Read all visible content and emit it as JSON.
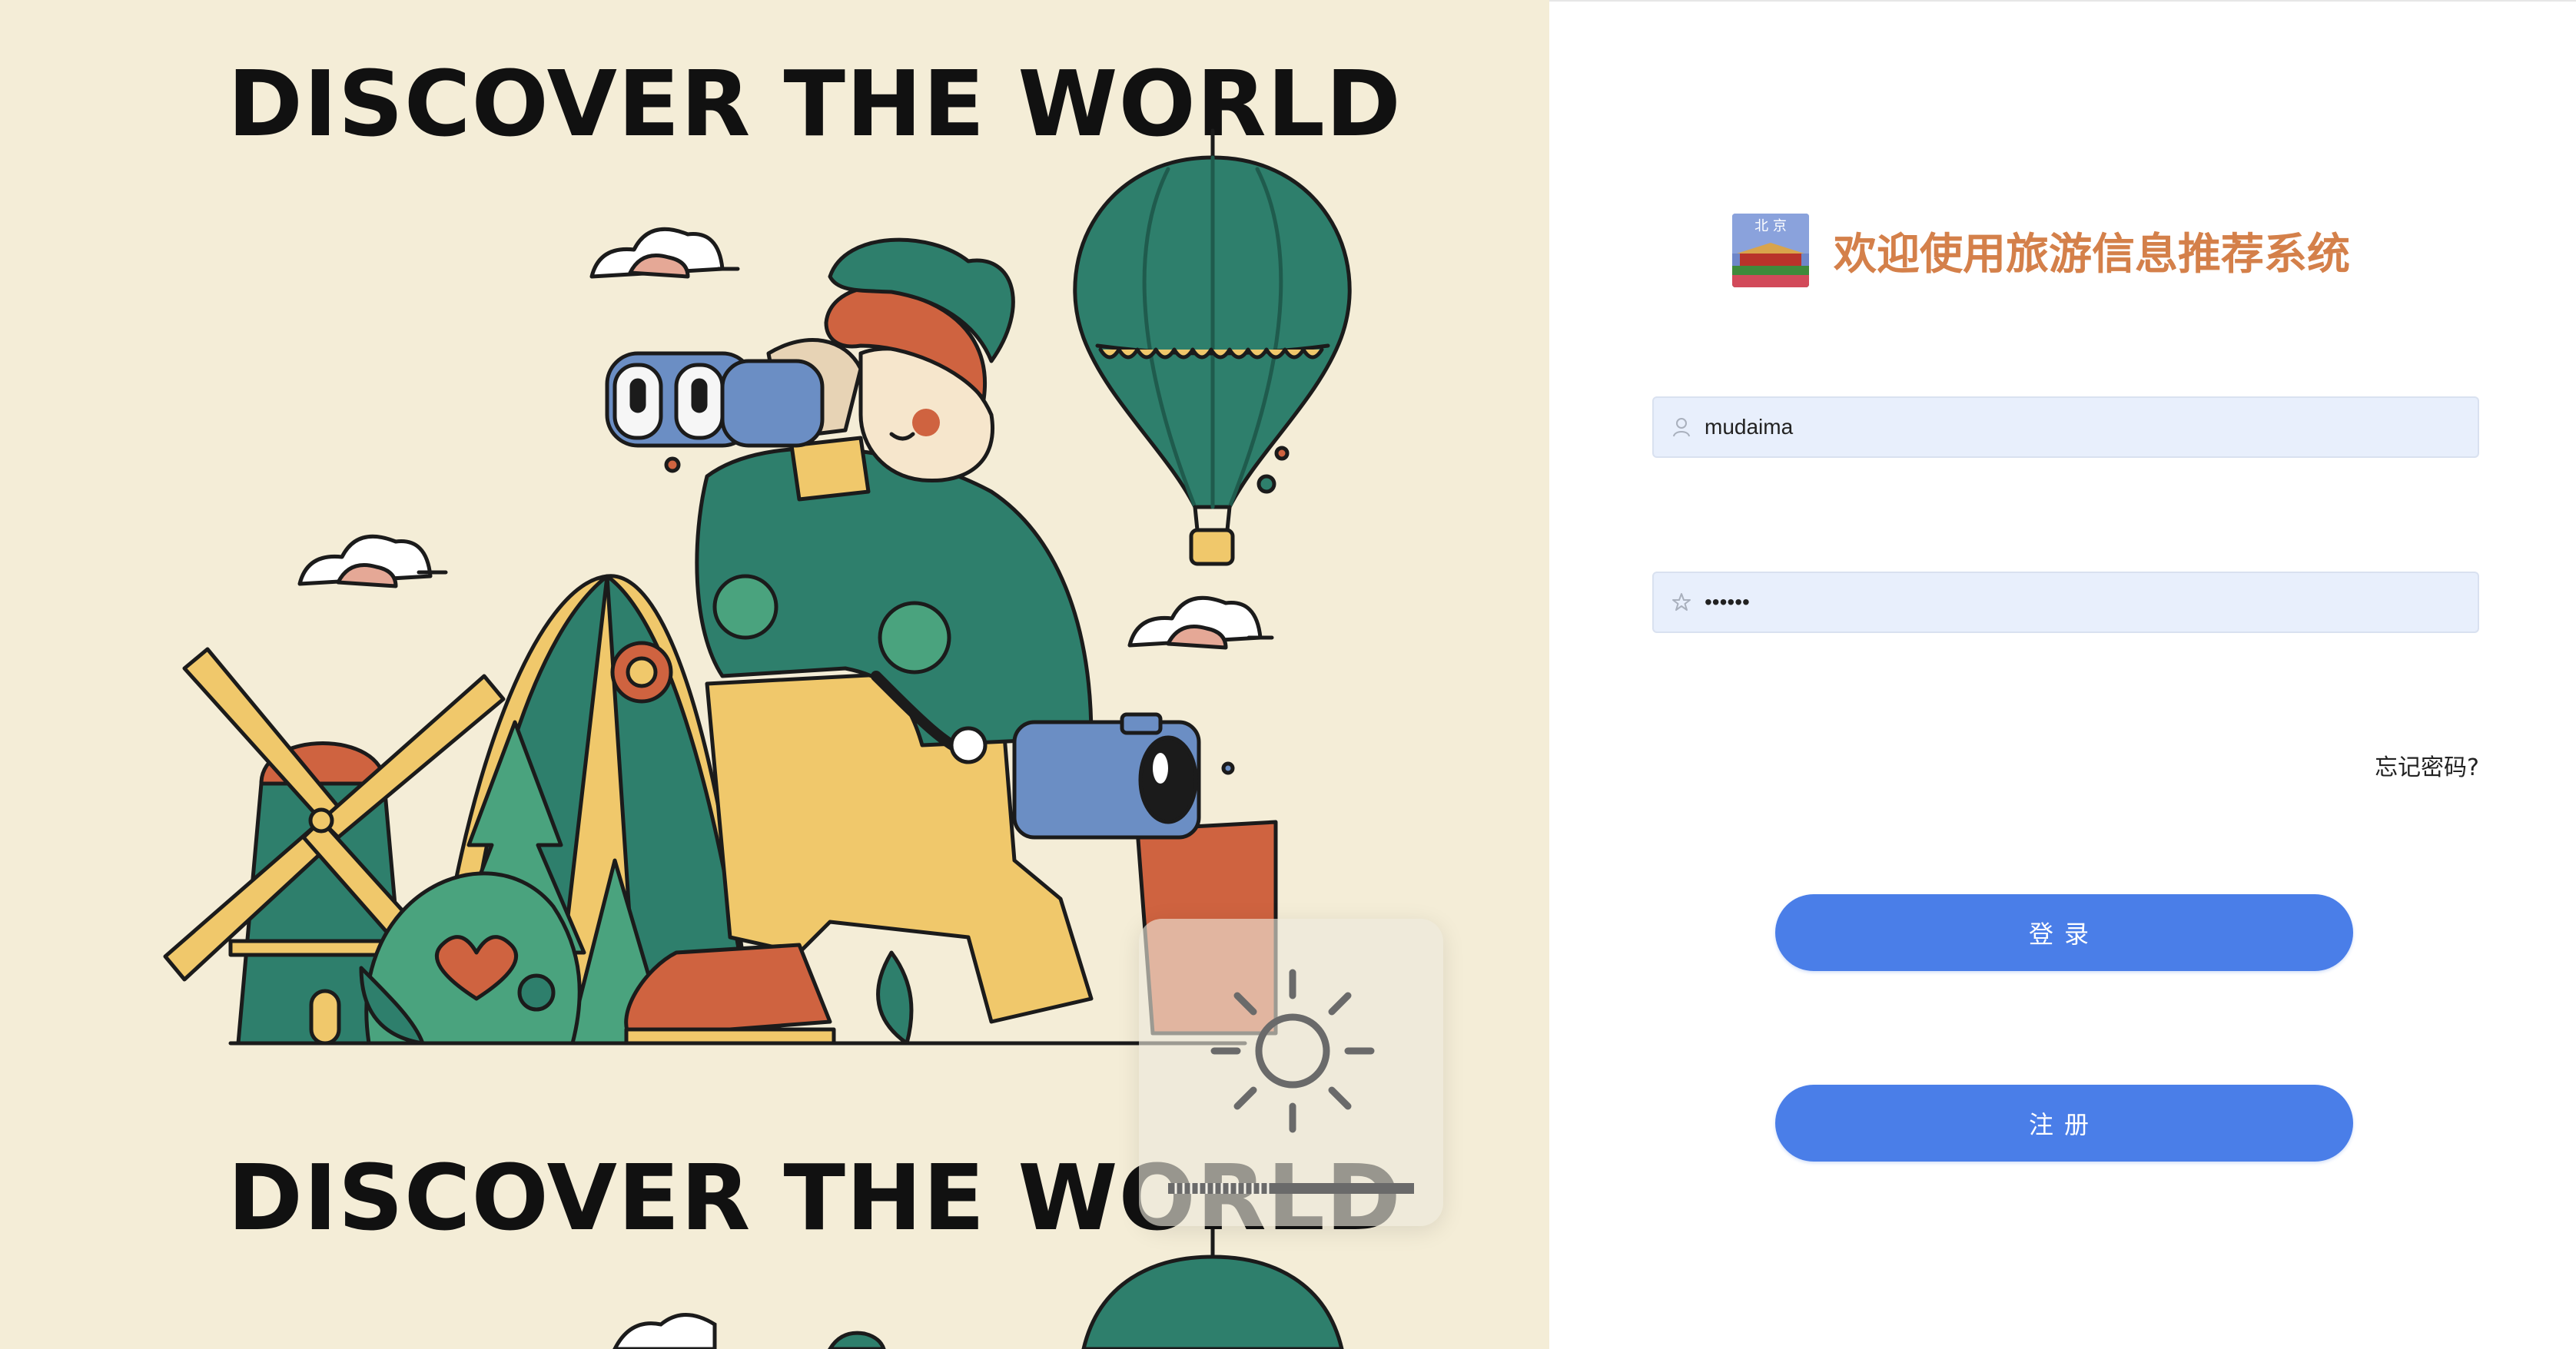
{
  "illustration": {
    "headline_top": "DISCOVER THE WORLD",
    "headline_bottom": "DISCOVER THE WORLD"
  },
  "brand": {
    "logo_icon": "beijing-tiananmen-logo",
    "title": "欢迎使用旅游信息推荐系统"
  },
  "login_form": {
    "username_value": "mudaima",
    "username_icon": "user-icon",
    "password_value": "••••••",
    "password_icon": "star-icon",
    "forgot_label": "忘记密码?",
    "login_label": "登录",
    "register_label": "注册"
  },
  "overlay": {
    "icon": "sun-brightness-icon"
  },
  "colors": {
    "left_background": "#f4edd7",
    "title_orange": "#d4804a",
    "button_blue": "#4a7ee8",
    "input_fill": "#e8effc",
    "teal": "#2e7f6c",
    "mustard": "#f0c86b",
    "rust": "#cf6340",
    "steel_blue": "#6b8ec4"
  }
}
